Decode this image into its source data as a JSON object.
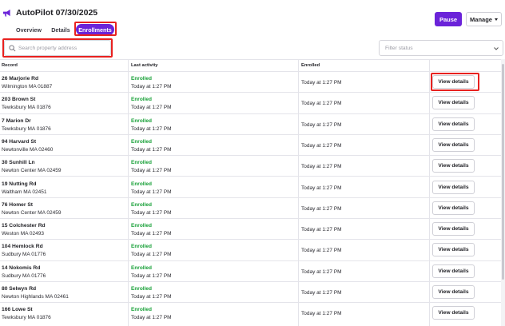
{
  "header": {
    "title": "AutoPilot 07/30/2025",
    "logo_icon": "megaphone-icon",
    "pause_label": "Pause",
    "manage_label": "Manage"
  },
  "tabs": [
    {
      "label": "Overview",
      "active": false
    },
    {
      "label": "Details",
      "active": false
    },
    {
      "label": "Enrollments",
      "active": true
    }
  ],
  "search": {
    "placeholder": "Search property address",
    "value": ""
  },
  "filter": {
    "placeholder": "Filter status"
  },
  "table": {
    "columns": [
      "Record",
      "Last activity",
      "Enrolled",
      ""
    ],
    "rows": [
      {
        "line1": "26 Marjorie Rd",
        "line2": "Wilmington MA 01887",
        "status": "Enrolled",
        "activity": "Today at 1:27 PM",
        "enrolled": "Today at 1:27 PM",
        "action": "View details"
      },
      {
        "line1": "203 Brown St",
        "line2": "Tewksbury MA 01876",
        "status": "Enrolled",
        "activity": "Today at 1:27 PM",
        "enrolled": "Today at 1:27 PM",
        "action": "View details"
      },
      {
        "line1": "7 Marion Dr",
        "line2": "Tewksbury MA 01876",
        "status": "Enrolled",
        "activity": "Today at 1:27 PM",
        "enrolled": "Today at 1:27 PM",
        "action": "View details"
      },
      {
        "line1": "94 Harvard St",
        "line2": "Newtonville MA 02460",
        "status": "Enrolled",
        "activity": "Today at 1:27 PM",
        "enrolled": "Today at 1:27 PM",
        "action": "View details"
      },
      {
        "line1": "30 Sunhill Ln",
        "line2": "Newton Center MA 02459",
        "status": "Enrolled",
        "activity": "Today at 1:27 PM",
        "enrolled": "Today at 1:27 PM",
        "action": "View details"
      },
      {
        "line1": "19 Nutting Rd",
        "line2": "Waltham MA 02451",
        "status": "Enrolled",
        "activity": "Today at 1:27 PM",
        "enrolled": "Today at 1:27 PM",
        "action": "View details"
      },
      {
        "line1": "76 Homer St",
        "line2": "Newton Center MA 02459",
        "status": "Enrolled",
        "activity": "Today at 1:27 PM",
        "enrolled": "Today at 1:27 PM",
        "action": "View details"
      },
      {
        "line1": "15 Colchester Rd",
        "line2": "Weston MA 02493",
        "status": "Enrolled",
        "activity": "Today at 1:27 PM",
        "enrolled": "Today at 1:27 PM",
        "action": "View details"
      },
      {
        "line1": "104 Hemlock Rd",
        "line2": "Sudbury MA 01776",
        "status": "Enrolled",
        "activity": "Today at 1:27 PM",
        "enrolled": "Today at 1:27 PM",
        "action": "View details"
      },
      {
        "line1": "14 Nokomis Rd",
        "line2": "Sudbury MA 01776",
        "status": "Enrolled",
        "activity": "Today at 1:27 PM",
        "enrolled": "Today at 1:27 PM",
        "action": "View details"
      },
      {
        "line1": "80 Selwyn Rd",
        "line2": "Newton Highlands MA 02461",
        "status": "Enrolled",
        "activity": "Today at 1:27 PM",
        "enrolled": "Today at 1:27 PM",
        "action": "View details"
      },
      {
        "line1": "166 Lowe St",
        "line2": "Tewksbury MA 01876",
        "status": "Enrolled",
        "activity": "Today at 1:27 PM",
        "enrolled": "Today at 1:27 PM",
        "action": "View details"
      }
    ]
  },
  "colors": {
    "accent": "#6b23d9",
    "status_green": "#18a038",
    "annotation_red": "#e8211f"
  }
}
